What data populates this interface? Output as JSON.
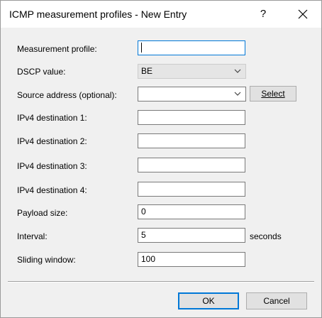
{
  "window": {
    "title": "ICMP measurement profiles - New Entry",
    "help_symbol": "?"
  },
  "form": {
    "measurement_profile": {
      "label": "Measurement profile:",
      "value": ""
    },
    "dscp": {
      "label": "DSCP value:",
      "selected": "BE"
    },
    "source_address": {
      "label": "Source address (optional):",
      "value": "",
      "button_label": "Select"
    },
    "ipv4_dest_1": {
      "label": "IPv4 destination 1:",
      "value": ""
    },
    "ipv4_dest_2": {
      "label": "IPv4 destination 2:",
      "value": ""
    },
    "ipv4_dest_3": {
      "label": "IPv4 destination 3:",
      "value": ""
    },
    "ipv4_dest_4": {
      "label": "IPv4 destination 4:",
      "value": ""
    },
    "payload_size": {
      "label": "Payload size:",
      "value": "0"
    },
    "interval": {
      "label": "Interval:",
      "value": "5",
      "unit": "seconds"
    },
    "sliding_window": {
      "label": "Sliding window:",
      "value": "100"
    }
  },
  "buttons": {
    "ok": "OK",
    "cancel": "Cancel"
  },
  "colors": {
    "focus": "#0078d7",
    "dialog_bg": "#f0f0f0"
  }
}
